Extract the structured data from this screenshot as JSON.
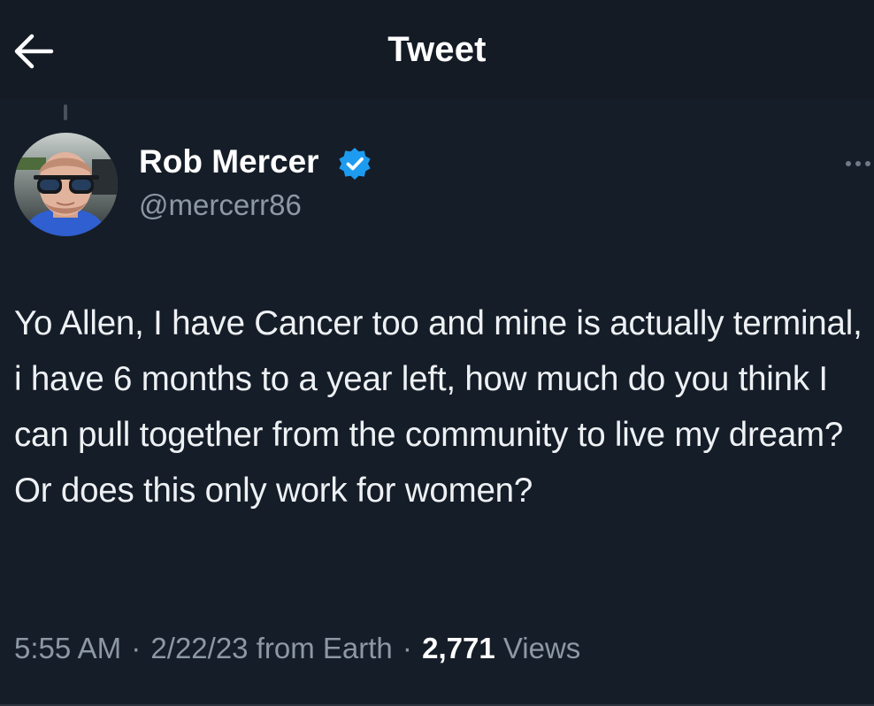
{
  "header": {
    "title": "Tweet"
  },
  "author": {
    "name": "Rob Mercer",
    "handle": "@mercerr86",
    "verified": true
  },
  "tweet": {
    "text": "Yo Allen, I have Cancer too and mine is actually terminal, i have 6 months to a year left, how much do you think I can pull together from the community to live my dream? Or does this only work for women?",
    "time": "5:55 AM",
    "date": "2/22/23",
    "source": "from Earth",
    "views_count": "2,771",
    "views_label": "Views",
    "separator": "·"
  },
  "icons": {
    "back": "back-arrow-icon",
    "verified": "verified-badge-icon",
    "more": "more-options-icon"
  },
  "colors": {
    "background": "#151d28",
    "text_primary": "#ffffff",
    "text_secondary": "#8d98a5",
    "verified_blue": "#1d9bf0"
  }
}
